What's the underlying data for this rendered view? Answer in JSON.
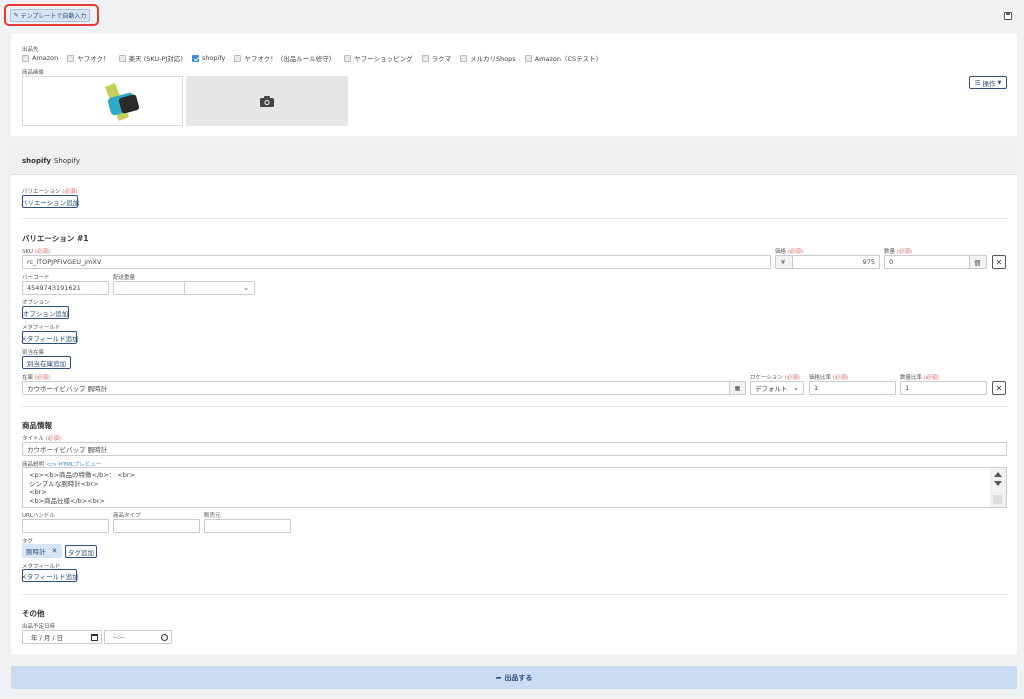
{
  "topbar": {
    "template_button": "テンプレートで自動入力"
  },
  "marketplace": {
    "label": "出品先",
    "items": [
      {
        "label": "Amazon",
        "checked": false
      },
      {
        "label": "ヤフオク！",
        "checked": false
      },
      {
        "label": "楽天 (SKU-PJ対応)",
        "checked": false
      },
      {
        "label": "shopify",
        "checked": true
      },
      {
        "label": "ヤフオク！（出品ルール修守）",
        "checked": false
      },
      {
        "label": "ヤフーショッピング",
        "checked": false
      },
      {
        "label": "ラクマ",
        "checked": false
      },
      {
        "label": "メルカリShops",
        "checked": false
      },
      {
        "label": "Amazon（CSテスト）",
        "checked": false
      }
    ]
  },
  "images": {
    "label": "商品画像",
    "ops_button": "操作"
  },
  "shopify_header": {
    "brand": "shopify",
    "name": "Shopify"
  },
  "variation": {
    "label": "バリエーション",
    "required": "(必須)",
    "add_button": "バリエーション追加",
    "title": "バリエーション #1",
    "sku_label": "SKU",
    "sku_value": "rc_lTOPJPFIVGEU_jmXV",
    "price_label": "価格",
    "price_currency": "¥",
    "price_value": "975",
    "qty_label": "数量",
    "qty_value": "0",
    "qty_unit": "個",
    "barcode_label": "バーコード",
    "barcode_value": "4549743191621",
    "weight_label": "配送重量",
    "option_label": "オプション",
    "option_button": "オプション追加",
    "metafield_label": "メタフィールド",
    "metafield_button": "メタフィールド追加",
    "stock_label": "別当在庫",
    "stock_button": "別当在庫追加",
    "inventory_label": "在庫",
    "inventory_value": "カウボーイビバップ 腕時計",
    "location_label": "ロケーション",
    "location_value": "デフォルト",
    "price_ratio_label": "価格比率",
    "price_ratio_value": "1",
    "qty_ratio_label": "数量比率",
    "qty_ratio_value": "1"
  },
  "product": {
    "section": "商品情報",
    "title_label": "タイトル",
    "title_value": "カウボーイビバップ 腕時計",
    "desc_label": "商品説明",
    "desc_preview": "</> HTMLプレビュー",
    "desc_lines": [
      "<p><b>商品の特徴</b>： <br>",
      "シンプルな腕時計<br>",
      "<br>",
      "<b>商品仕様</b><br>"
    ],
    "handle_label": "URLハンドル",
    "type_label": "商品タイプ",
    "vendor_label": "販売元",
    "tag_label": "タグ",
    "tag_value": "腕時計",
    "tag_button": "タグ追加",
    "metafield_label": "メタフィールド",
    "metafield_button": "メタフィールド追加"
  },
  "other": {
    "section": "その他",
    "date_label": "出品予定日時",
    "date_placeholder": "年 / 月 / 日",
    "time_placeholder": "--:--"
  },
  "submit": {
    "label": "出品する"
  },
  "colors": {
    "accent": "#2d4f7c",
    "submit_bg": "#c9dcf2",
    "required": "#e06060",
    "check": "#3b8fd6"
  }
}
